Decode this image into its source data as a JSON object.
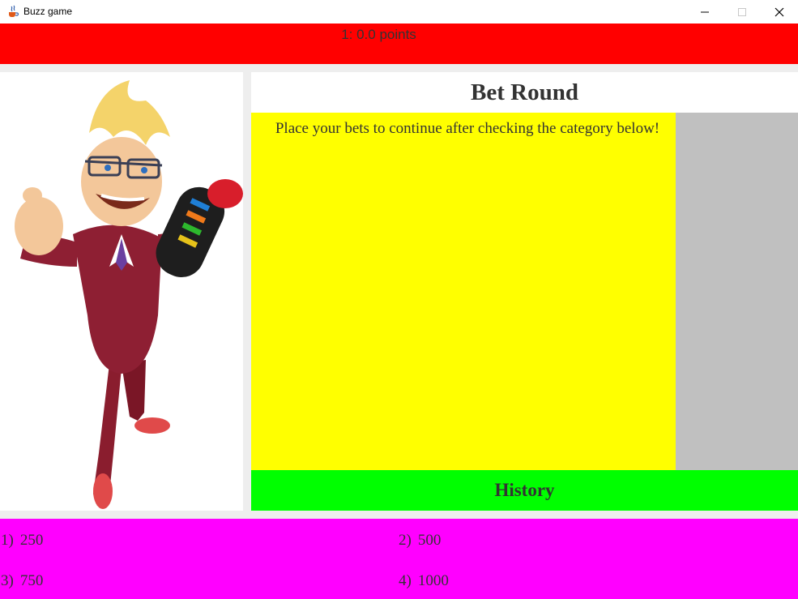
{
  "window": {
    "title": "Buzz game",
    "icon": "java-cup-icon"
  },
  "score": {
    "text": "1: 0.0 points"
  },
  "round": {
    "title": "Bet Round",
    "instruction": "Place your bets to continue after checking the category below!"
  },
  "history": {
    "label": "History"
  },
  "answers": [
    {
      "num": "1)",
      "value": "250"
    },
    {
      "num": "2)",
      "value": "500"
    },
    {
      "num": "3)",
      "value": "750"
    },
    {
      "num": "4)",
      "value": "1000"
    }
  ],
  "colors": {
    "score_bar": "#ff0000",
    "question_area": "#ffff00",
    "side_panel": "#c0c0c0",
    "history_bar": "#00ff00",
    "answers_panel": "#ff00ff"
  },
  "host": {
    "description_icon": "buzz-host-character"
  }
}
